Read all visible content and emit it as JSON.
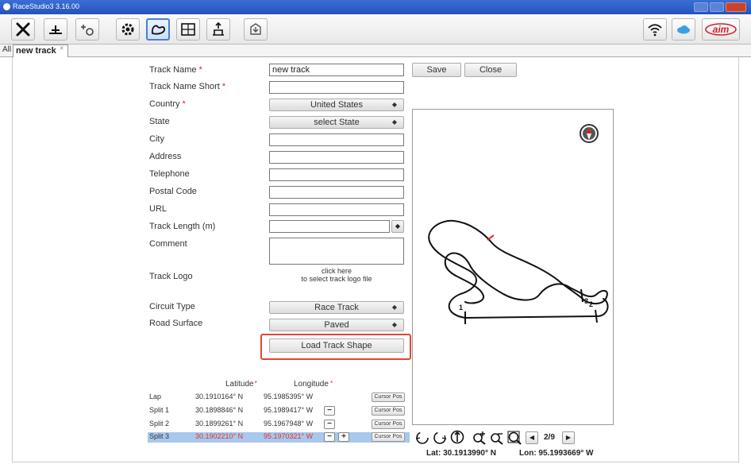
{
  "window": {
    "title": "RaceStudio3 3.16.00"
  },
  "toolbar": {
    "icons": [
      "tools-icon",
      "balance-icon",
      "add-device-icon",
      "gear-icon",
      "track-icon",
      "grid-map-icon",
      "upload-icon",
      "download-icon"
    ],
    "right_icons": [
      "wifi-icon",
      "cloud-icon",
      "aim-logo"
    ],
    "logo_text": "aim"
  },
  "tabs": {
    "all_label": "All",
    "active_label": "new track"
  },
  "form": {
    "track_name": {
      "label": "Track Name",
      "value": "new track"
    },
    "track_name_short": {
      "label": "Track Name Short",
      "value": ""
    },
    "country": {
      "label": "Country",
      "value": "United States"
    },
    "state": {
      "label": "State",
      "value": "select State"
    },
    "city": {
      "label": "City",
      "value": ""
    },
    "address": {
      "label": "Address",
      "value": ""
    },
    "telephone": {
      "label": "Telephone",
      "value": ""
    },
    "postal_code": {
      "label": "Postal Code",
      "value": ""
    },
    "url": {
      "label": "URL",
      "value": ""
    },
    "track_length": {
      "label": "Track Length (m)",
      "value": ""
    },
    "comment": {
      "label": "Comment",
      "value": ""
    },
    "track_logo": {
      "label": "Track Logo",
      "line1": "click here",
      "line2": "to select track logo file"
    },
    "circuit_type": {
      "label": "Circuit Type",
      "value": "Race Track"
    },
    "road_surface": {
      "label": "Road Surface",
      "value": "Paved"
    },
    "load_track_shape": "Load Track Shape",
    "save": "Save",
    "close": "Close",
    "required_mark": "*"
  },
  "coords": {
    "lat_header": "Latitude",
    "lon_header": "Longitude",
    "cursor_pos": "Cursor Pos",
    "rows": [
      {
        "name": "Lap",
        "lat": "30.1910164° N",
        "lon": "95.1985395° W"
      },
      {
        "name": "Split 1",
        "lat": "30.1898846° N",
        "lon": "95.1989417° W"
      },
      {
        "name": "Split 2",
        "lat": "30.1899261° N",
        "lon": "95.1967948° W"
      },
      {
        "name": "Split 3",
        "lat": "30.1902210° N",
        "lon": "95.1970321° W"
      }
    ]
  },
  "map": {
    "page": "2/9",
    "lat": "Lat: 30.1913990° N",
    "lon": "Lon: 95.1993669° W",
    "marker_labels": [
      "1",
      "3",
      "2"
    ]
  },
  "colors": {
    "accent_red": "#e0453a",
    "selection": "#a8c8ec",
    "titlebar": "#2f60c7"
  }
}
